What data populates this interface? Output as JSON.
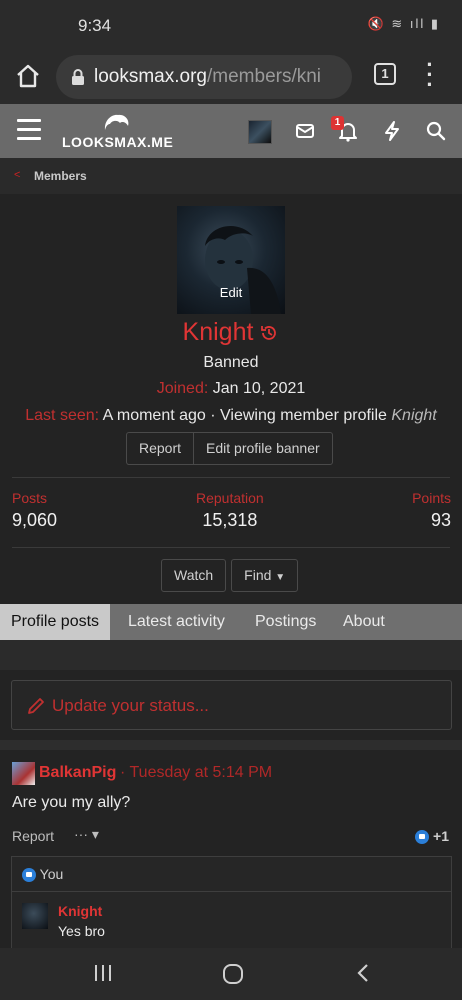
{
  "status_bar": {
    "time": "9:34",
    "icons": "🔇 ≋ ıll ▮"
  },
  "browser": {
    "url_domain": "looksmax.org",
    "url_path": "/members/kni",
    "tab_count": "1"
  },
  "site": {
    "logo_text": "LOOKSMAX.ME",
    "notification_count": "1"
  },
  "breadcrumb": {
    "label": "Members"
  },
  "profile": {
    "avatar_edit_label": "Edit",
    "name": "Knight",
    "title": "Banned",
    "joined_label": "Joined:",
    "joined_value": "Jan 10, 2021",
    "last_seen_label": "Last seen:",
    "last_seen_value": "A moment ago · Viewing member profile",
    "last_seen_italic": "Knight",
    "report_label": "Report",
    "edit_banner_label": "Edit profile banner",
    "stats": [
      {
        "label": "Posts",
        "value": "9,060"
      },
      {
        "label": "Reputation",
        "value": "15,318"
      },
      {
        "label": "Points",
        "value": "93"
      }
    ],
    "watch_label": "Watch",
    "find_label": "Find"
  },
  "tabs": [
    {
      "label": "Profile posts",
      "active": true
    },
    {
      "label": "Latest activity"
    },
    {
      "label": "Postings"
    },
    {
      "label": "About"
    }
  ],
  "status_update": {
    "placeholder": "Update your status..."
  },
  "post": {
    "author": "BalkanPig",
    "date": "· Tuesday at 5:14 PM",
    "body": "Are you my ally?",
    "report_label": "Report",
    "more_label": "··· ▾",
    "like_count": "+1",
    "liked_by": "You",
    "reply": {
      "author": "Knight",
      "text": "Yes bro"
    }
  },
  "colors": {
    "accent_red": "#e03535",
    "header_gray": "#6a6a6a",
    "background": "#232323"
  }
}
